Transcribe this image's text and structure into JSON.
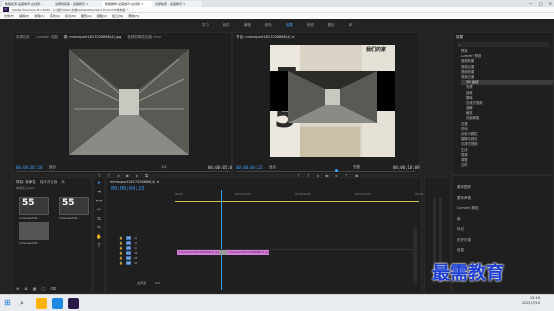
{
  "browser": {
    "tabs": [
      "教程检索-最需教育-在线家...",
      "全网视频库 - 最需教育 ×",
      "教程推荐-最需教育-在线家 ×",
      "全部免费 - 最需教育 ×"
    ],
    "controls": [
      "—",
      "□",
      "✕"
    ]
  },
  "app_title": "Adobe Premiere Pro 2020 - C:\\用户\\Mac\\文档\\Adobe\\Premiere Pro\\14.0\\未命名 *",
  "menu": [
    "文件(F)",
    "编辑(E)",
    "剪辑(C)",
    "序列(S)",
    "标记(M)",
    "图形(G)",
    "视图(V)",
    "窗口(W)",
    "帮助(H)"
  ],
  "workspaces": [
    "学习",
    "组件",
    "编辑",
    "颜色",
    "效果",
    "音频",
    "图形",
    "库"
  ],
  "active_workspace": "效果",
  "source_monitor": {
    "tabs": [
      "效果控件",
      "Lumetri 范围",
      "源: mmexport1627028666(4).jpg",
      "音频剪辑混合器: mm"
    ],
    "timecode_left": "00;00;05;18",
    "fit": "适合",
    "fraction": "1/2",
    "timecode_right": "00;00;05;08"
  },
  "program_monitor": {
    "title": "节目: mmexport1627028666(4) ≡",
    "timecode_left": "00;00;04;23",
    "fit": "适合",
    "fraction": "完整",
    "timecode_right": "00;00;10;09",
    "sign_text": "我们的家"
  },
  "effects_panel": {
    "title": "效果",
    "tree": [
      "预设",
      "Lumetri 预设",
      "音频效果",
      "音频过渡",
      "视频效果",
      "视频过渡",
      "3D 运动",
      "内滑",
      "划像",
      "擦除",
      "沉浸式视频",
      "溶解",
      "缩放",
      "页面剥落",
      "过渡",
      "时间",
      "杂色与颗粒",
      "模糊与锐化",
      "沉浸式视频",
      "生成",
      "视频",
      "调整",
      "过时"
    ],
    "selected_index": 6,
    "lower_sections": [
      "基本图形",
      "基本声音",
      "Lumetri 颜色",
      "库",
      "标记",
      "历史记录",
      "信息"
    ]
  },
  "project_panel": {
    "tabs": [
      "项目: 未命名",
      "媒体浏览器",
      "库",
      "信息",
      "效果",
      "标记"
    ],
    "file_label": "未命名.prproj",
    "items": [
      "mmexport16...",
      "mmexport16...",
      "mmexport16..."
    ]
  },
  "timeline": {
    "sequence_tab": "mmexport1627028666(4) ≡",
    "timecode": "00;00;04;23",
    "ruler": [
      "00;00",
      "00;00;04;00",
      "00;00;08;00",
      "00;00;12;00",
      "00;00;16;00"
    ],
    "tracks": [
      "V3",
      "V2",
      "V1",
      "A1",
      "A2",
      "A3"
    ],
    "master": "主声道",
    "master_value": "0.0",
    "clip1": "mmexport1627028666(4).jpg",
    "clip2": "mmexport1627028666(4).jpg"
  },
  "watermark": "最需教育",
  "taskbar": {
    "time": "15:16",
    "date": "2021/7/24"
  },
  "colors": {
    "accent": "#3ba1ff",
    "clip": "#d57ed7",
    "watermark": "#1d3fd4"
  }
}
